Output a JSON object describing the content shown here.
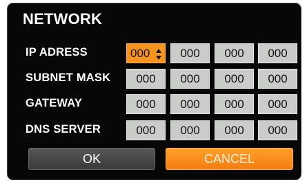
{
  "dialog": {
    "title": "NETWORK",
    "rows": [
      {
        "label": "IP ADRESS",
        "fields": [
          "000",
          "000",
          "000",
          "000"
        ],
        "active_field": 0
      },
      {
        "label": "SUBNET MASK",
        "fields": [
          "000",
          "000",
          "000",
          "000"
        ]
      },
      {
        "label": "GATEWAY",
        "fields": [
          "000",
          "000",
          "000",
          "000"
        ]
      },
      {
        "label": "DNS SERVER",
        "fields": [
          "000",
          "000",
          "000",
          "000"
        ]
      }
    ],
    "ok_label": "OK",
    "cancel_label": "CANCEL"
  },
  "colors": {
    "background": "#070707",
    "field": "#c9ccc9",
    "accent": "#f7941d",
    "ok_button": "#4a4a4a"
  },
  "icons": {
    "spinner": "up-down-arrows-icon"
  }
}
